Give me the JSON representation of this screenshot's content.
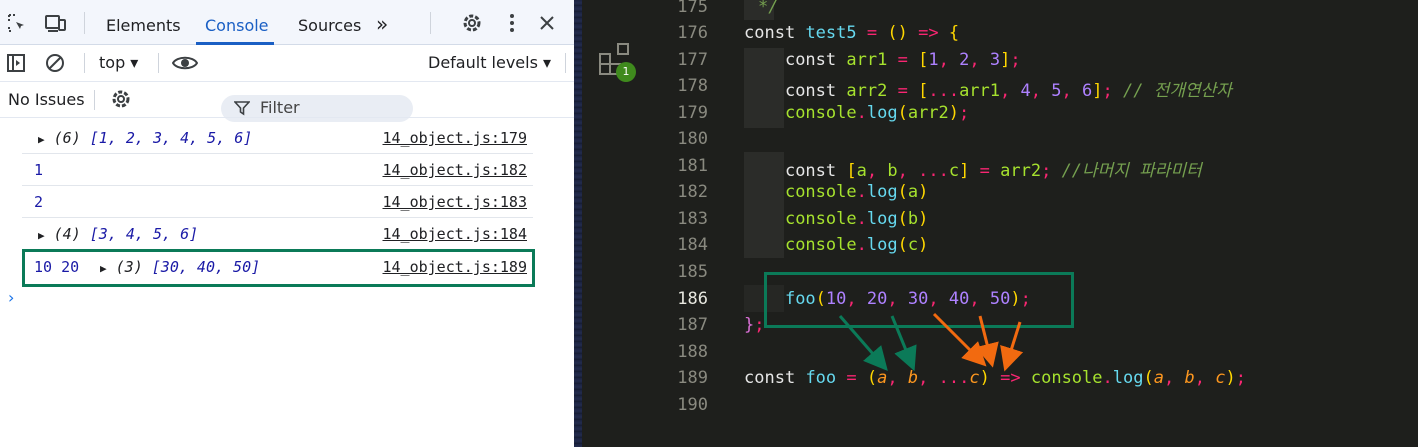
{
  "devtools": {
    "tabs": [
      "Elements",
      "Console",
      "Sources"
    ],
    "active_tab": "Console",
    "more_tabs": "»",
    "context": "top ▾",
    "filter_placeholder": "Filter",
    "levels": "Default levels ▾",
    "issues": "No Issues",
    "logs": [
      {
        "count": "(6)",
        "values": "[1, 2, 3, 4, 5, 6]",
        "source": "14_object.js:179"
      },
      {
        "text": "1",
        "source": "14_object.js:182"
      },
      {
        "text": "2",
        "source": "14_object.js:183"
      },
      {
        "count": "(4)",
        "values": "[3, 4, 5, 6]",
        "source": "14_object.js:184"
      },
      {
        "prefix": "10 20",
        "count": "(3)",
        "values": "[30, 40, 50]",
        "source": "14_object.js:189"
      }
    ],
    "prompt": "›",
    "icons": [
      "inspect-icon",
      "device-toggle-icon",
      "settings-icon",
      "more-vert-icon",
      "close-icon",
      "sidebar-icon",
      "clear-icon",
      "eye-icon",
      "filter-icon",
      "gear-icon"
    ]
  },
  "editor": {
    "badge": "1",
    "lines": [
      {
        "n": "175",
        "text": "*/"
      },
      {
        "n": "176",
        "text": "const test5 = () => {"
      },
      {
        "n": "177",
        "text": "const arr1 = [1, 2, 3];"
      },
      {
        "n": "178",
        "text": "const arr2 = [...arr1, 4, 5, 6]; // 전개연산자"
      },
      {
        "n": "179",
        "text": "console.log(arr2);"
      },
      {
        "n": "180",
        "text": ""
      },
      {
        "n": "181",
        "text": "const [a, b, ...c] = arr2; //나머지 파라미터"
      },
      {
        "n": "182",
        "text": "console.log(a)"
      },
      {
        "n": "183",
        "text": "console.log(b)"
      },
      {
        "n": "184",
        "text": "console.log(c)"
      },
      {
        "n": "185",
        "text": ""
      },
      {
        "n": "186",
        "text": "foo(10, 20, 30, 40, 50);"
      },
      {
        "n": "187",
        "text": "};"
      },
      {
        "n": "188",
        "text": ""
      },
      {
        "n": "189",
        "text": "const foo = (a, b, ...c) => console.log(a, b, c);"
      },
      {
        "n": "190",
        "text": ""
      }
    ],
    "current_line": "186",
    "colors": {
      "highlight_box": "#0b7a58",
      "arrow_green": "#0b7a58",
      "arrow_orange": "#f26a10"
    }
  }
}
